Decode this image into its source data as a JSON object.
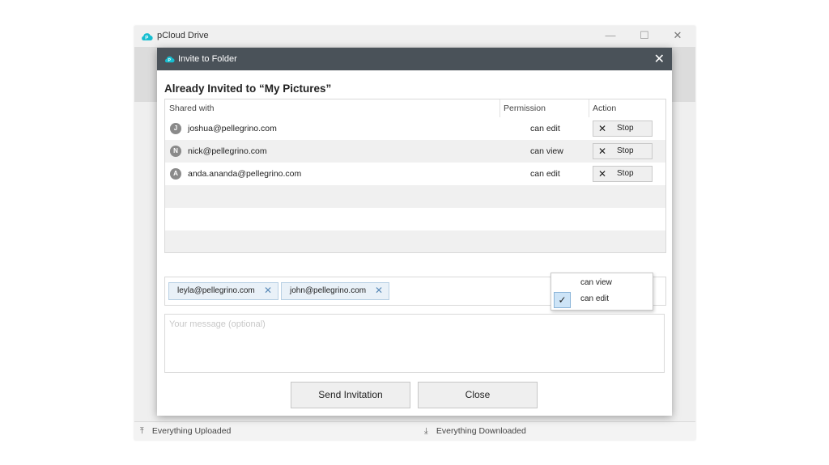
{
  "app": {
    "title": "pCloud Drive"
  },
  "window_controls": {
    "minimize": "—",
    "maximize": "☐",
    "close": "✕"
  },
  "status_bar": {
    "uploaded": "Everything Uploaded",
    "downloaded": "Everything Downloaded",
    "uploaded_icon": "upload-arrow-icon",
    "downloaded_icon": "download-arrow-icon"
  },
  "dialog": {
    "title": "Invite to Folder",
    "close": "✕",
    "heading": "Already Invited to “My Pictures”",
    "columns": {
      "shared_with": "Shared with",
      "permission": "Permission",
      "action": "Action"
    },
    "rows": [
      {
        "initial": "J",
        "email": "joshua@pellegrino.com",
        "permission": "can edit",
        "action": "Stop"
      },
      {
        "initial": "N",
        "email": "nick@pellegrino.com",
        "permission": "can view",
        "action": "Stop"
      },
      {
        "initial": "A",
        "email": "anda.ananda@pellegrino.com",
        "permission": "can edit",
        "action": "Stop"
      }
    ],
    "invitees": [
      {
        "email": "leyla@pellegrino.com"
      },
      {
        "email": "john@pellegrino.com"
      }
    ],
    "permission_dropdown": {
      "options": [
        "can view",
        "can edit"
      ],
      "selected": "can edit",
      "check": "✓"
    },
    "message": {
      "placeholder": "Your message (optional)",
      "value": ""
    },
    "buttons": {
      "send": "Send Invitation",
      "close": "Close"
    }
  },
  "colors": {
    "dialog_titlebar": "#4a5259",
    "brand": "#17bed0",
    "chip_bg": "#e9f1f8",
    "chip_border": "#b8d0e4",
    "selected_check_bg": "#cde4f7"
  }
}
